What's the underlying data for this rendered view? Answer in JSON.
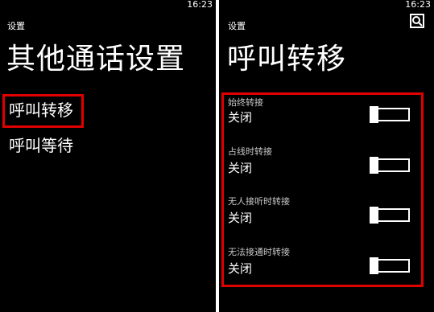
{
  "status_bar": {
    "left_time": "16:23",
    "right_time": "16:23"
  },
  "left_screen": {
    "app_label": "设置",
    "title": "其他通话设置",
    "items": [
      {
        "label": "呼叫转移"
      },
      {
        "label": "呼叫等待"
      }
    ]
  },
  "right_screen": {
    "app_label": "设置",
    "title": "呼叫转移",
    "search_icon": "search-icon",
    "settings": [
      {
        "label": "始终转接",
        "value": "关闭",
        "enabled": false
      },
      {
        "label": "占线时转接",
        "value": "关闭",
        "enabled": false
      },
      {
        "label": "无人接听时转接",
        "value": "关闭",
        "enabled": false
      },
      {
        "label": "无法接通时转接",
        "value": "关闭",
        "enabled": false
      }
    ]
  },
  "colors": {
    "background": "#000000",
    "foreground": "#ffffff",
    "highlight": "#e00000",
    "secondary_text": "#c8c8c8"
  }
}
